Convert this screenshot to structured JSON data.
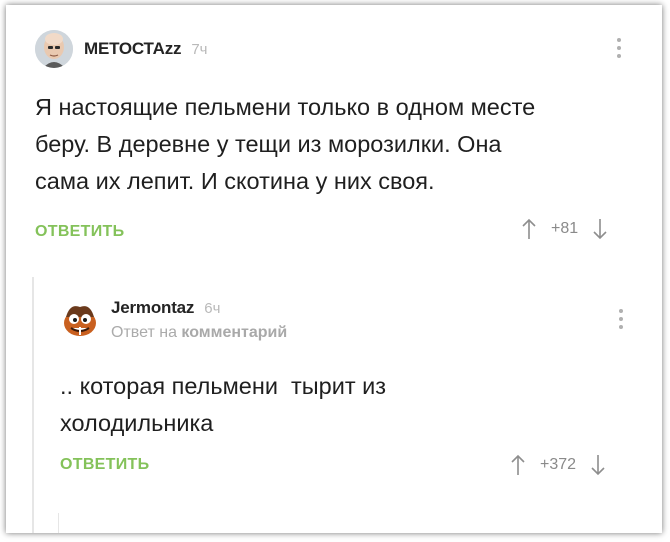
{
  "comments": [
    {
      "author": "МЕТОСТАzz",
      "time": "7ч",
      "text_lines": [
        "Я настоящие пельмени только в одном месте",
        "беру. В деревне у тещи из морозилки. Она",
        "сама их лепит. И скотина у них своя."
      ],
      "reply_label": "ОТВЕТИТЬ",
      "score": "+81",
      "avatar_icon": "bald-man-avatar-icon",
      "menu_icon": "more-vertical-icon"
    },
    {
      "author": "Jermontaz",
      "time": "6ч",
      "reply_prefix": "Ответ на",
      "reply_link": "комментарий",
      "text_lines": [
        ".. которая пельмени  тырит из",
        "холодильника"
      ],
      "reply_label": "ОТВЕТИТЬ",
      "score": "+372",
      "avatar_icon": "cartoon-monster-avatar-icon",
      "menu_icon": "more-vertical-icon"
    }
  ],
  "colors": {
    "accent_green": "#84c25a",
    "muted_text": "#ababab",
    "thread_line": "#e6e6e6"
  }
}
